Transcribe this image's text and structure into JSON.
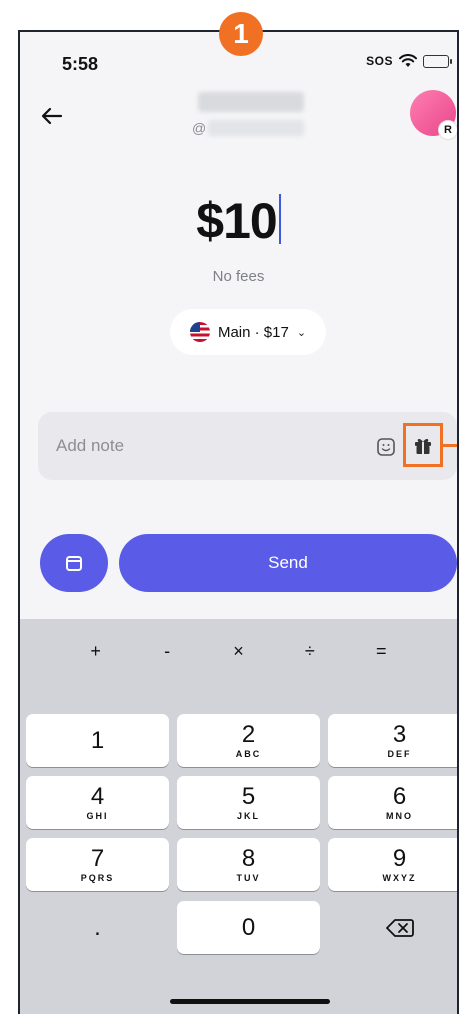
{
  "step_badge": "1",
  "status_bar": {
    "time": "5:58",
    "sos": "SOS"
  },
  "header": {
    "handle_prefix": "@",
    "avatar_badge": "R"
  },
  "payment": {
    "amount": "$10",
    "fees": "No fees",
    "account": "Main · $17"
  },
  "note": {
    "placeholder": "Add note"
  },
  "actions": {
    "send": "Send"
  },
  "keyboard": {
    "operators": [
      "+",
      "-",
      "×",
      "÷",
      "="
    ],
    "keys": [
      {
        "num": "1",
        "letters": ""
      },
      {
        "num": "2",
        "letters": "ABC"
      },
      {
        "num": "3",
        "letters": "DEF"
      },
      {
        "num": "4",
        "letters": "GHI"
      },
      {
        "num": "5",
        "letters": "JKL"
      },
      {
        "num": "6",
        "letters": "MNO"
      },
      {
        "num": "7",
        "letters": "PQRS"
      },
      {
        "num": "8",
        "letters": "TUV"
      },
      {
        "num": "9",
        "letters": "WXYZ"
      },
      {
        "num": ".",
        "letters": ""
      },
      {
        "num": "0",
        "letters": ""
      }
    ]
  },
  "colors": {
    "accent": "#5a5be6",
    "highlight": "#f07024"
  }
}
